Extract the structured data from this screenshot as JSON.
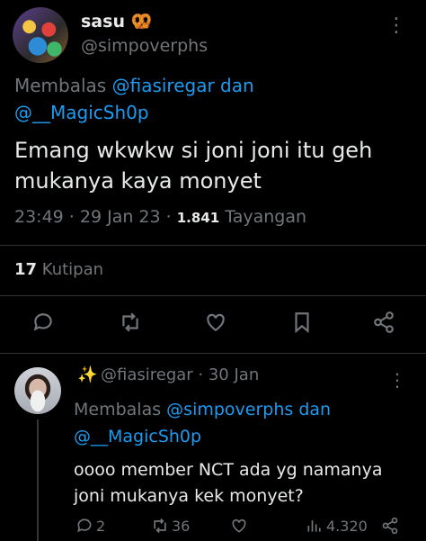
{
  "main_tweet": {
    "display_name": "sasu",
    "name_emoji": "🥨",
    "handle": "@simpoverphs",
    "reply_prefix": "Membalas",
    "reply_user1": "@fiasiregar",
    "reply_and": "dan",
    "reply_user2": "@__MagicSh0p",
    "text_line1": "Emang wkwkw si joni joni itu geh",
    "text_line2": "mukanya kaya monyet",
    "time": "23:49",
    "date": "29 Jan 23",
    "views_count": "1.841",
    "views_label": "Tayangan",
    "quotes_count": "17",
    "quotes_label": "Kutipan"
  },
  "reply_tweet": {
    "emoji": "✨",
    "handle": "@fiasiregar",
    "date": "30 Jan",
    "reply_prefix": "Membalas",
    "reply_user1": "@simpoverphs",
    "reply_and": "dan",
    "reply_user2": "@__MagicSh0p",
    "text_line1": "oooo member NCT ada yg namanya",
    "text_line2": "joni mukanya kek monyet?",
    "replies": "2",
    "retweets": "36",
    "views": "4.320"
  },
  "icons": [
    "more-icon",
    "reply-icon",
    "retweet-icon",
    "like-icon",
    "bookmark-icon",
    "share-icon",
    "views-icon"
  ],
  "colors": {
    "background": "#000000",
    "text": "#e7e9ea",
    "muted": "#71767b",
    "link": "#1d9bf0",
    "divider": "#2f3336"
  }
}
